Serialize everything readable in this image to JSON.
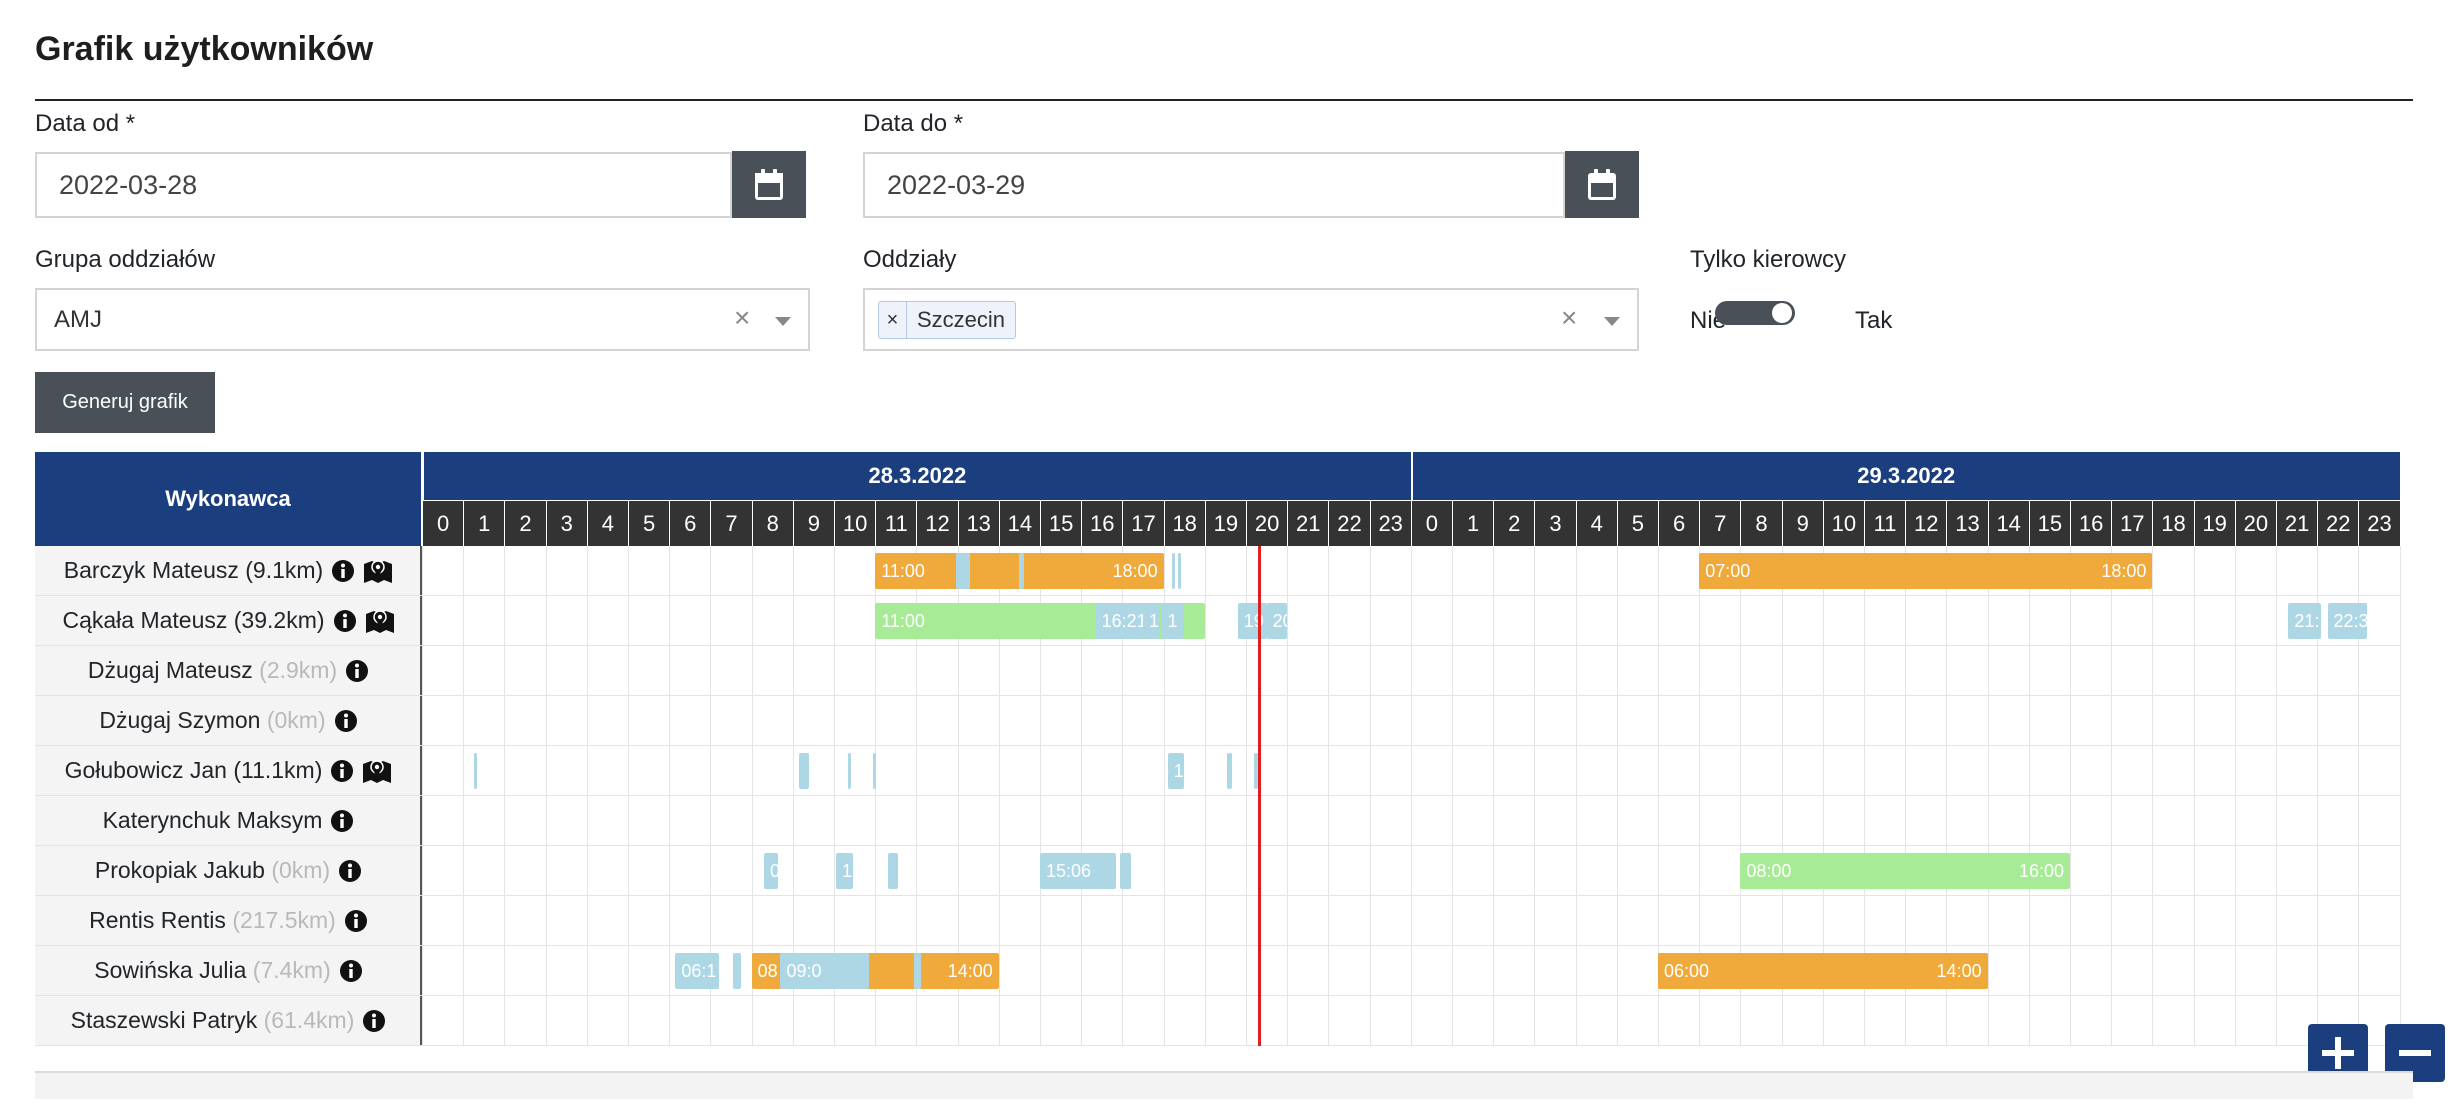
{
  "page": {
    "title": "Grafik użytkowników"
  },
  "filters": {
    "date_from": {
      "label": "Data od *",
      "value": "2022-03-28"
    },
    "date_to": {
      "label": "Data do *",
      "value": "2022-03-29"
    },
    "group": {
      "label": "Grupa oddziałów",
      "value": "AMJ"
    },
    "branches": {
      "label": "Oddziały",
      "tag": "Szczecin",
      "tag_remove": "×"
    },
    "drivers_only": {
      "label": "Tylko kierowcy",
      "off_label": "Nie",
      "on_label": "Tak",
      "checked": true
    },
    "clear_symbol": "×"
  },
  "generate_button": {
    "label": "Generuj grafik"
  },
  "schedule": {
    "executor_header": "Wykonawca",
    "days": [
      "28.3.2022",
      "29.3.2022"
    ],
    "hours": [
      "0",
      "1",
      "2",
      "3",
      "4",
      "5",
      "6",
      "7",
      "8",
      "9",
      "10",
      "11",
      "12",
      "13",
      "14",
      "15",
      "16",
      "17",
      "18",
      "19",
      "20",
      "21",
      "22",
      "23"
    ],
    "now_hour": 20.3,
    "rows": [
      {
        "name": "Barczyk Mateusz (9.1km)",
        "km": "",
        "info": true,
        "map": true
      },
      {
        "name": "Cąkała Mateusz (39.2km)",
        "km": "",
        "info": true,
        "map": true
      },
      {
        "name": "Dżugaj Mateusz",
        "km": "(2.9km)",
        "info": true,
        "map": false
      },
      {
        "name": "Dżugaj Szymon",
        "km": "(0km)",
        "info": true,
        "map": false
      },
      {
        "name": "Gołubowicz Jan (11.1km)",
        "km": "",
        "info": true,
        "map": true
      },
      {
        "name": "Katerynchuk Maksym",
        "km": "",
        "info": true,
        "map": false
      },
      {
        "name": "Prokopiak Jakub",
        "km": "(0km)",
        "info": true,
        "map": false
      },
      {
        "name": "Rentis Rentis",
        "km": "(217.5km)",
        "info": true,
        "map": false
      },
      {
        "name": "Sowińska Julia",
        "km": "(7.4km)",
        "info": true,
        "map": false
      },
      {
        "name": "Staszewski Patryk",
        "km": "(61.4km)",
        "info": true,
        "map": false
      }
    ],
    "bars": [
      {
        "row": 0,
        "start": 11.0,
        "end": 18.0,
        "color": "orange",
        "start_label": "11:00",
        "end_label": "18:00"
      },
      {
        "row": 0,
        "start": 12.95,
        "end": 13.3,
        "color": "blue",
        "start_label": "",
        "end_label": ""
      },
      {
        "row": 0,
        "start": 14.5,
        "end": 14.6,
        "color": "blue",
        "start_label": "",
        "end_label": ""
      },
      {
        "row": 0,
        "start": 18.2,
        "end": 18.25,
        "color": "blue",
        "start_label": "",
        "end_label": ""
      },
      {
        "row": 0,
        "start": 18.35,
        "end": 18.4,
        "color": "blue",
        "start_label": "",
        "end_label": ""
      },
      {
        "row": 0,
        "start": 31.0,
        "end": 42.0,
        "color": "orange",
        "start_label": "07:00",
        "end_label": "18:00"
      },
      {
        "row": 1,
        "start": 11.0,
        "end": 19.0,
        "color": "green",
        "start_label": "11:00",
        "end_label": ""
      },
      {
        "row": 1,
        "start": 16.35,
        "end": 17.5,
        "color": "blue",
        "start_label": "16:21",
        "end_label": ""
      },
      {
        "row": 1,
        "start": 17.5,
        "end": 17.9,
        "color": "blue",
        "start_label": "1",
        "end_label": ""
      },
      {
        "row": 1,
        "start": 17.95,
        "end": 18.5,
        "color": "blue",
        "start_label": "1",
        "end_label": ""
      },
      {
        "row": 1,
        "start": 19.8,
        "end": 20.5,
        "color": "blue",
        "start_label": "19",
        "end_label": ""
      },
      {
        "row": 1,
        "start": 20.5,
        "end": 21.0,
        "color": "blue",
        "start_label": "20:3",
        "end_label": ""
      },
      {
        "row": 1,
        "start": 45.3,
        "end": 46.1,
        "color": "blue",
        "start_label": "21:1",
        "end_label": ""
      },
      {
        "row": 1,
        "start": 46.25,
        "end": 47.2,
        "color": "blue",
        "start_label": "22:3",
        "end_label": ""
      },
      {
        "row": 4,
        "start": 1.25,
        "end": 1.32,
        "color": "blue",
        "start_label": "",
        "end_label": ""
      },
      {
        "row": 4,
        "start": 9.15,
        "end": 9.4,
        "color": "blue",
        "start_label": "",
        "end_label": ""
      },
      {
        "row": 4,
        "start": 10.95,
        "end": 11.02,
        "color": "blue",
        "start_label": "",
        "end_label": ""
      },
      {
        "row": 4,
        "start": 10.35,
        "end": 10.42,
        "color": "blue",
        "start_label": "",
        "end_label": ""
      },
      {
        "row": 4,
        "start": 18.1,
        "end": 18.5,
        "color": "blue",
        "start_label": "1",
        "end_label": ""
      },
      {
        "row": 4,
        "start": 19.55,
        "end": 19.65,
        "color": "blue",
        "start_label": "",
        "end_label": ""
      },
      {
        "row": 4,
        "start": 20.2,
        "end": 20.3,
        "color": "blue",
        "start_label": "",
        "end_label": ""
      },
      {
        "row": 6,
        "start": 8.3,
        "end": 8.65,
        "color": "blue",
        "start_label": "0",
        "end_label": ""
      },
      {
        "row": 6,
        "start": 10.05,
        "end": 10.45,
        "color": "blue",
        "start_label": "1",
        "end_label": ""
      },
      {
        "row": 6,
        "start": 11.3,
        "end": 11.55,
        "color": "blue",
        "start_label": "",
        "end_label": ""
      },
      {
        "row": 6,
        "start": 15.0,
        "end": 16.85,
        "color": "blue",
        "start_label": "15:06",
        "end_label": ""
      },
      {
        "row": 6,
        "start": 16.95,
        "end": 17.2,
        "color": "blue",
        "start_label": "",
        "end_label": ""
      },
      {
        "row": 6,
        "start": 32.0,
        "end": 40.0,
        "color": "green",
        "start_label": "08:00",
        "end_label": "16:00"
      },
      {
        "row": 8,
        "start": 6.15,
        "end": 7.2,
        "color": "blue",
        "start_label": "06:1",
        "end_label": ""
      },
      {
        "row": 8,
        "start": 7.55,
        "end": 7.75,
        "color": "blue",
        "start_label": "",
        "end_label": ""
      },
      {
        "row": 8,
        "start": 8.0,
        "end": 14.0,
        "color": "orange",
        "start_label": "08",
        "end_label": "14:00"
      },
      {
        "row": 8,
        "start": 8.7,
        "end": 10.85,
        "color": "blue",
        "start_label": "09:0",
        "end_label": ""
      },
      {
        "row": 8,
        "start": 11.95,
        "end": 12.1,
        "color": "blue",
        "start_label": "",
        "end_label": ""
      },
      {
        "row": 8,
        "start": 30.0,
        "end": 38.0,
        "color": "orange",
        "start_label": "06:00",
        "end_label": "14:00"
      }
    ]
  },
  "zoom": {
    "in": "zoom-in",
    "out": "zoom-out"
  },
  "colors": {
    "header": "#1b3f7e",
    "hours": "#333333",
    "orange": "#f0a93b",
    "green": "#a7eb97",
    "blue": "#aed7e6",
    "now_line": "#e02020",
    "button": "#495057"
  }
}
